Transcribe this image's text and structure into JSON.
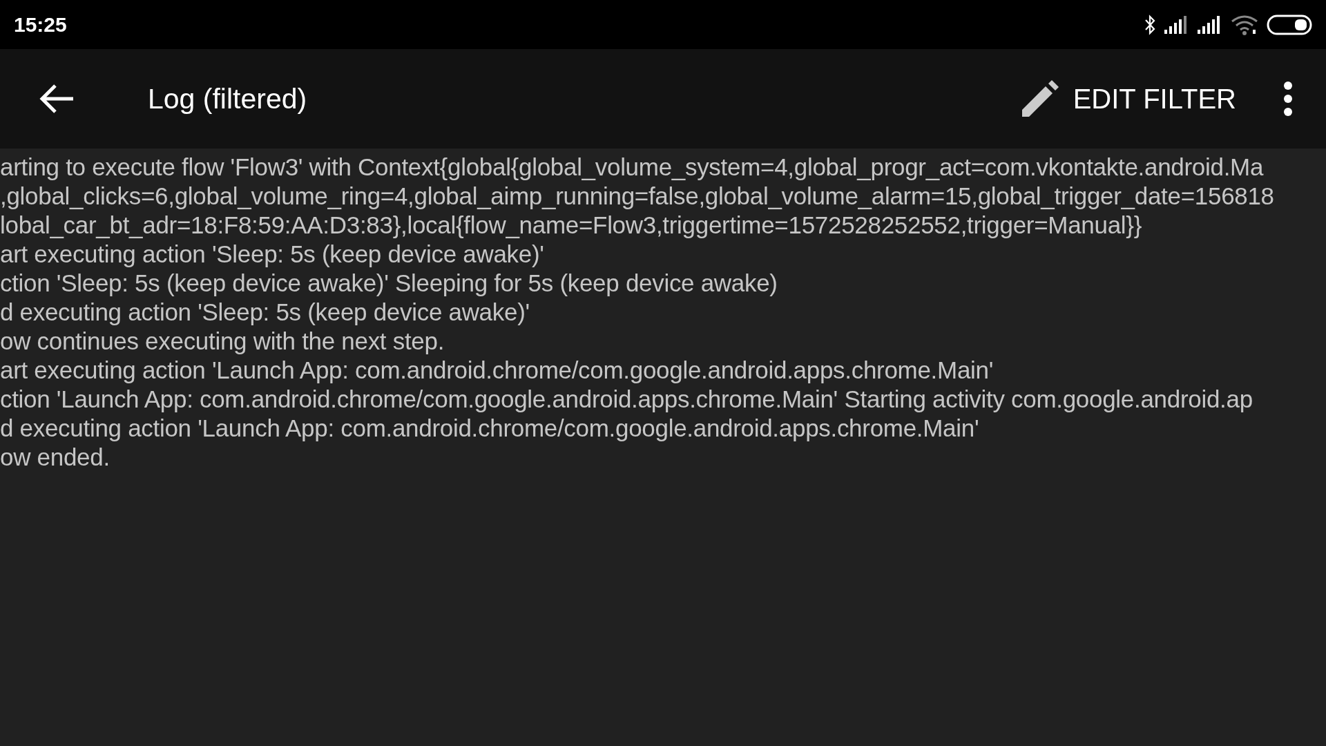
{
  "status_bar": {
    "time": "15:25"
  },
  "toolbar": {
    "title": "Log (filtered)",
    "action": "EDIT FILTER"
  },
  "log": {
    "lines": [
      "arting to execute flow 'Flow3' with Context{global{global_volume_system=4,global_progr_act=com.vkontakte.android.Ma",
      ",global_clicks=6,global_volume_ring=4,global_aimp_running=false,global_volume_alarm=15,global_trigger_date=156818",
      "lobal_car_bt_adr=18:F8:59:AA:D3:83},local{flow_name=Flow3,triggertime=1572528252552,trigger=Manual}}",
      "art executing action 'Sleep: 5s (keep device awake)'",
      "ction 'Sleep: 5s (keep device awake)' Sleeping for 5s (keep device awake)",
      "d executing action 'Sleep: 5s (keep device awake)'",
      "ow continues executing with the next step.",
      "art executing action 'Launch App: com.android.chrome/com.google.android.apps.chrome.Main'",
      "ction 'Launch App: com.android.chrome/com.google.android.apps.chrome.Main' Starting activity com.google.android.ap",
      "d executing action 'Launch App: com.android.chrome/com.google.android.apps.chrome.Main'",
      "ow ended."
    ]
  }
}
